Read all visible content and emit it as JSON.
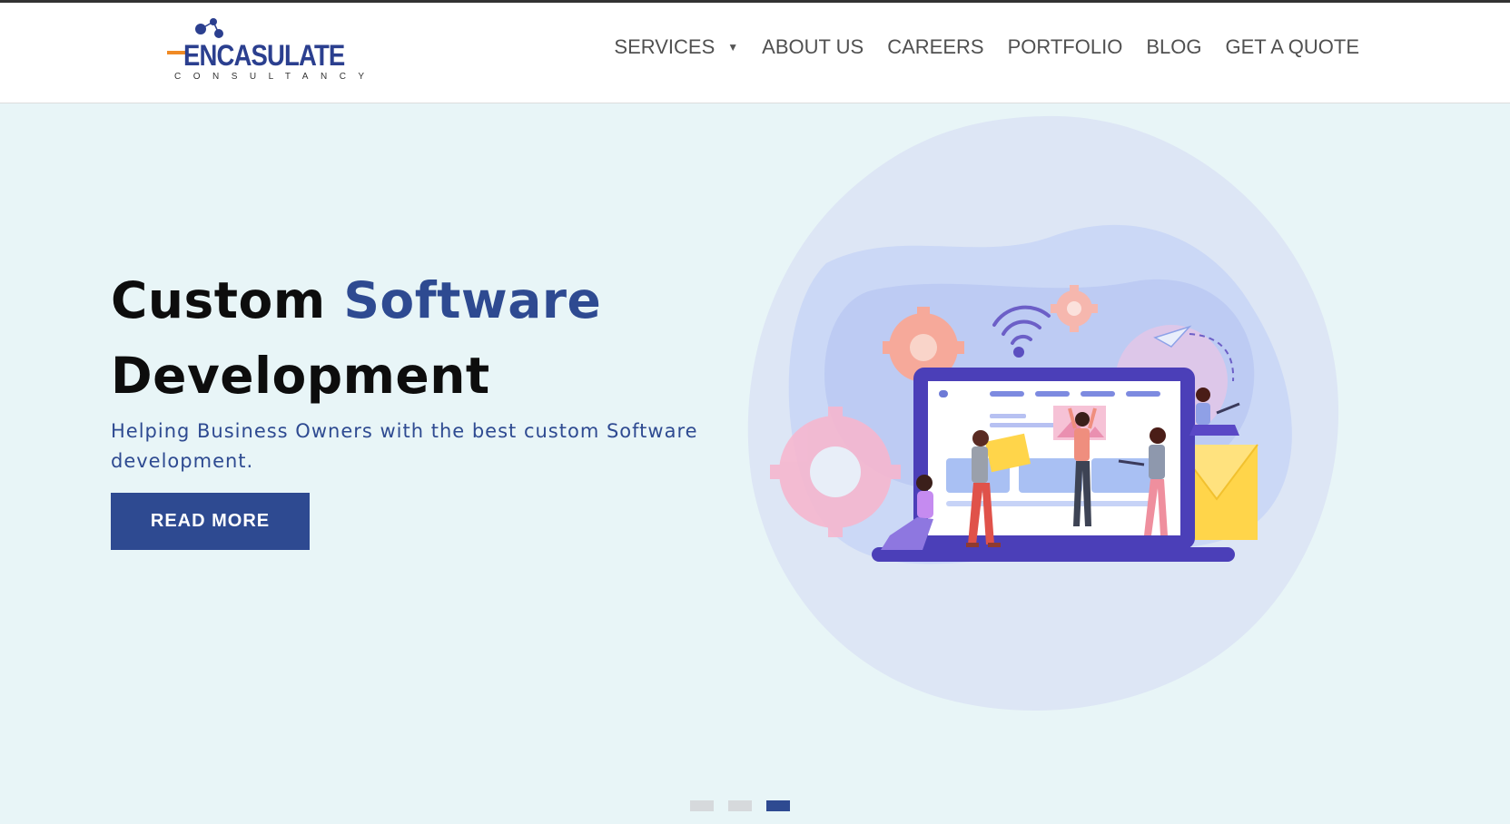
{
  "brand": {
    "logo_text": "ENCASULATE",
    "logo_subtext": "CONSULTANCY"
  },
  "nav": {
    "items": [
      {
        "label": "SERVICES",
        "has_dropdown": true
      },
      {
        "label": "ABOUT US"
      },
      {
        "label": "CAREERS"
      },
      {
        "label": "PORTFOLIO"
      },
      {
        "label": "BLOG"
      },
      {
        "label": "GET A QUOTE"
      }
    ],
    "dropdown_icon": "caret-down-icon"
  },
  "hero": {
    "title_part1": "Custom",
    "title_accent": "Software",
    "title_line2": "Development",
    "subtitle": "Helping Business Owners with the best custom Software development.",
    "cta_label": "READ MORE",
    "illustration": "laptop-teamwork-illustration"
  },
  "slider": {
    "slide_count": 3,
    "active_index": 2
  },
  "colors": {
    "accent": "#2e4a91",
    "background": "#e8f5f7",
    "header_bg": "#ffffff",
    "nav_text": "#505050"
  }
}
